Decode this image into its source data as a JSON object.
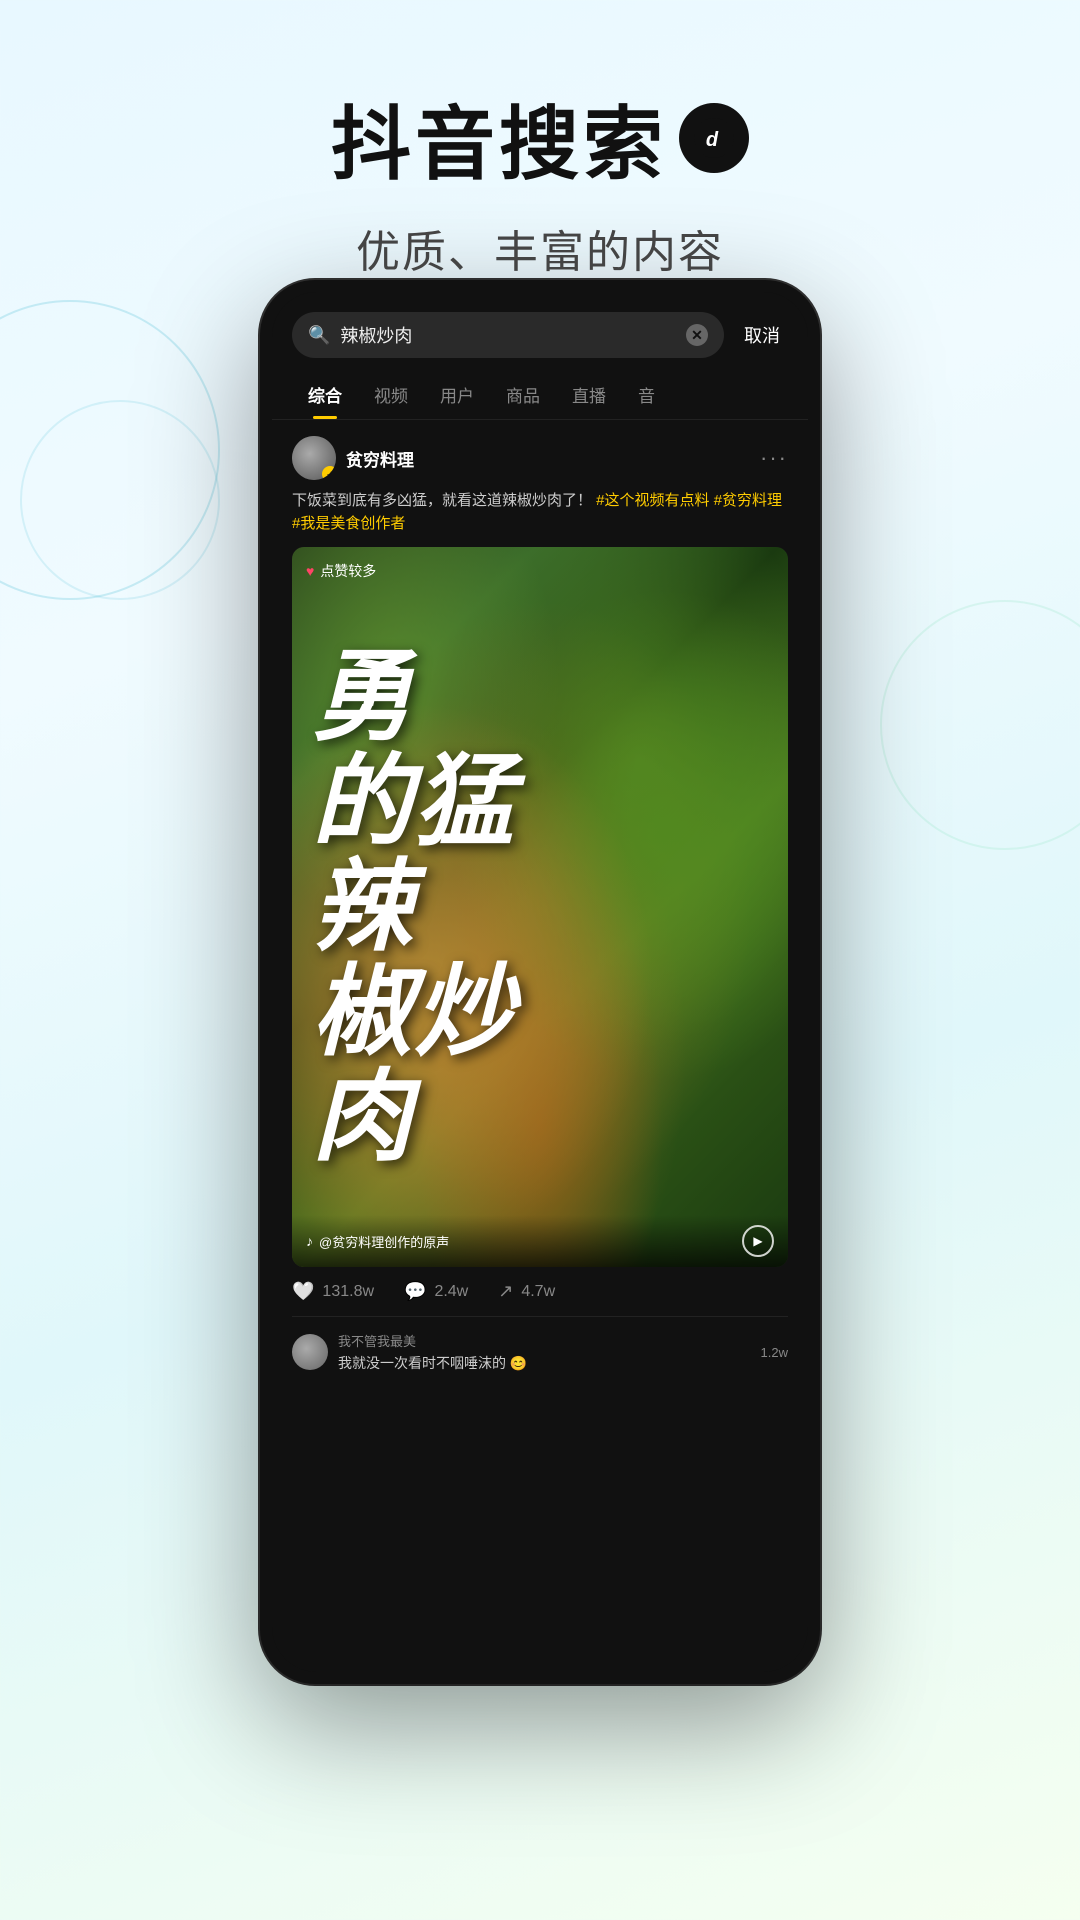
{
  "app": {
    "title": "抖音搜索",
    "tiktok_logo": "♪",
    "subtitle": "优质、丰富的内容"
  },
  "search": {
    "query": "辣椒炒肉",
    "placeholder": "辣椒炒肉",
    "cancel_label": "取消"
  },
  "tabs": [
    {
      "label": "综合",
      "active": true
    },
    {
      "label": "视频",
      "active": false
    },
    {
      "label": "用户",
      "active": false
    },
    {
      "label": "商品",
      "active": false
    },
    {
      "label": "直播",
      "active": false
    },
    {
      "label": "音",
      "active": false
    }
  ],
  "post": {
    "author": "贫穷料理",
    "verified": true,
    "description": "下饭菜到底有多凶猛，就看这道辣椒炒肉了！",
    "hashtags": [
      "#这个视频有点料",
      "#贫穷料理",
      "#我是美食创作者"
    ],
    "likes_badge": "点赞较多",
    "video_text": "勇\n的猛\n辣\n椒炒\n肉",
    "video_lines": [
      "勇",
      "的猛",
      "辣",
      "椒炒",
      "肉"
    ],
    "audio_label": "@贫穷料理创作的原声",
    "stats": {
      "likes": "131.8w",
      "comments": "2.4w",
      "shares": "4.7w"
    }
  },
  "comments": [
    {
      "author": "我不管我最美",
      "text": "我就没一次看时不咽唾沫的 😊",
      "likes": "1.2w"
    }
  ]
}
